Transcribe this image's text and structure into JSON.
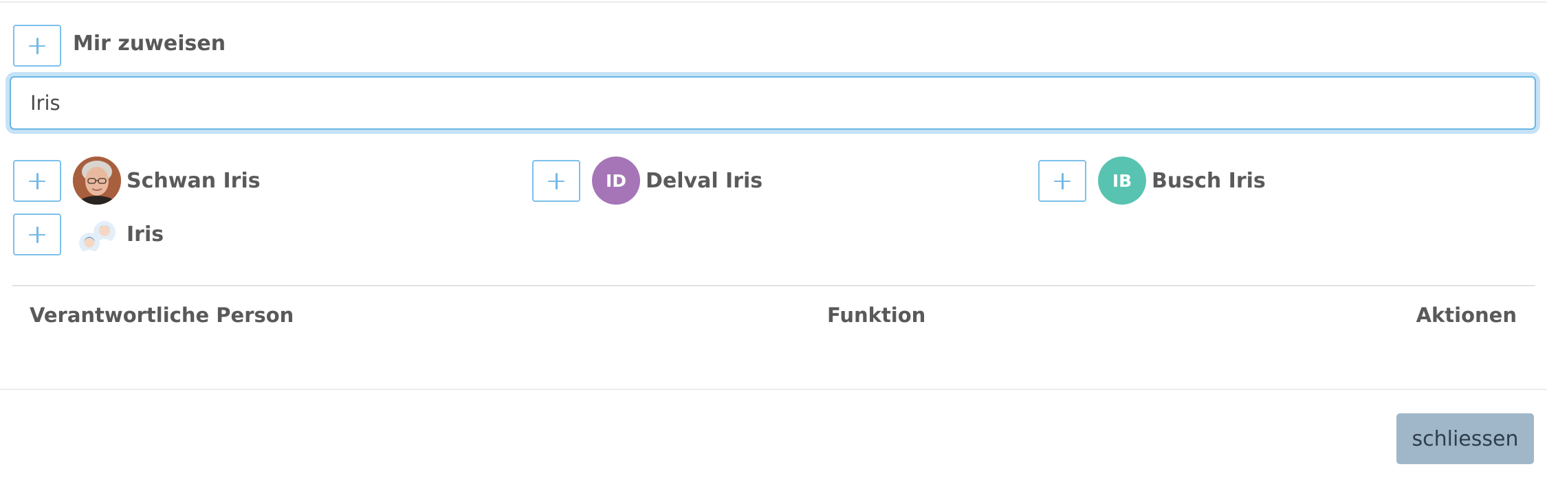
{
  "assign_me": {
    "label": "Mir zuweisen",
    "icon": "plus-icon"
  },
  "search": {
    "value": "Iris",
    "placeholder": ""
  },
  "results": [
    {
      "name": "Schwan Iris",
      "avatar_type": "photo",
      "initials": ""
    },
    {
      "name": "Delval Iris",
      "avatar_type": "initials",
      "initials": "ID",
      "avatar_color": "#a675b7"
    },
    {
      "name": "Busch Iris",
      "avatar_type": "initials",
      "initials": "IB",
      "avatar_color": "#58c3b0"
    },
    {
      "name": "Iris",
      "avatar_type": "group-icon",
      "initials": ""
    }
  ],
  "table": {
    "columns": [
      "Verantwortliche Person",
      "Funktion",
      "Aktionen"
    ],
    "rows": []
  },
  "footer": {
    "close_label": "schliessen"
  },
  "colors": {
    "accent": "#69b6e4",
    "button_border": "#7cc0ea",
    "close_button": "#9fb7c9"
  }
}
